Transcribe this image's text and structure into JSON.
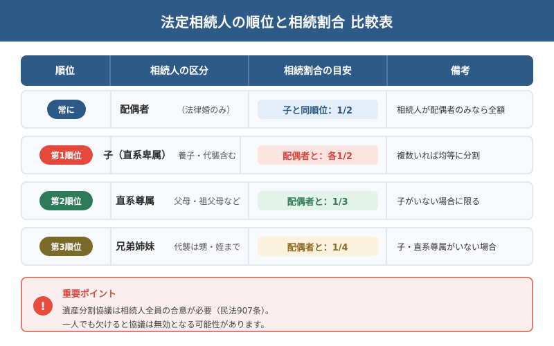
{
  "title": "法定相続人の順位と相続割合 比較表",
  "headers": [
    "順位",
    "相続人の区分",
    "相続割合の目安",
    "備考"
  ],
  "rows": [
    {
      "rank": "常に",
      "rank_color": "#2d5a87",
      "heir_name": "配偶者",
      "heir_detail": "（法律婚のみ）",
      "ratio": "子と同順位：1/2",
      "ratio_bg": "#e3eef8",
      "ratio_color": "#2d5a87",
      "note": "相続人が配偶者のみなら全額"
    },
    {
      "rank": "第1順位",
      "rank_color": "#e5483d",
      "heir_name": "子（直系卑属）",
      "heir_detail": "養子・代襲含む",
      "ratio": "配偶者と：各1/2",
      "ratio_bg": "#fbe3e1",
      "ratio_color": "#d9473b",
      "note": "複数いれば均等に分割"
    },
    {
      "rank": "第2順位",
      "rank_color": "#2e7b5a",
      "heir_name": "直系尊属",
      "heir_detail": "父母・祖父母など",
      "ratio": "配偶者と：1/3",
      "ratio_bg": "#e3f3ea",
      "ratio_color": "#2e7b5a",
      "note": "子がいない場合に限る"
    },
    {
      "rank": "第3順位",
      "rank_color": "#7a6a2a",
      "heir_name": "兄弟姉妹",
      "heir_detail": "代襲は甥・姪まで",
      "ratio": "配偶者と：1/4",
      "ratio_bg": "#fbf1df",
      "ratio_color": "#8a6a1e",
      "note": "子・直系尊属がいない場合"
    }
  ],
  "point": {
    "icon": "exclamation-icon",
    "title": "重要ポイント",
    "line1": "遺産分割協議は相続人全員の合意が必要（民法907条）。",
    "line2": "一人でも欠けると協議は無効となる可能性があります。"
  }
}
